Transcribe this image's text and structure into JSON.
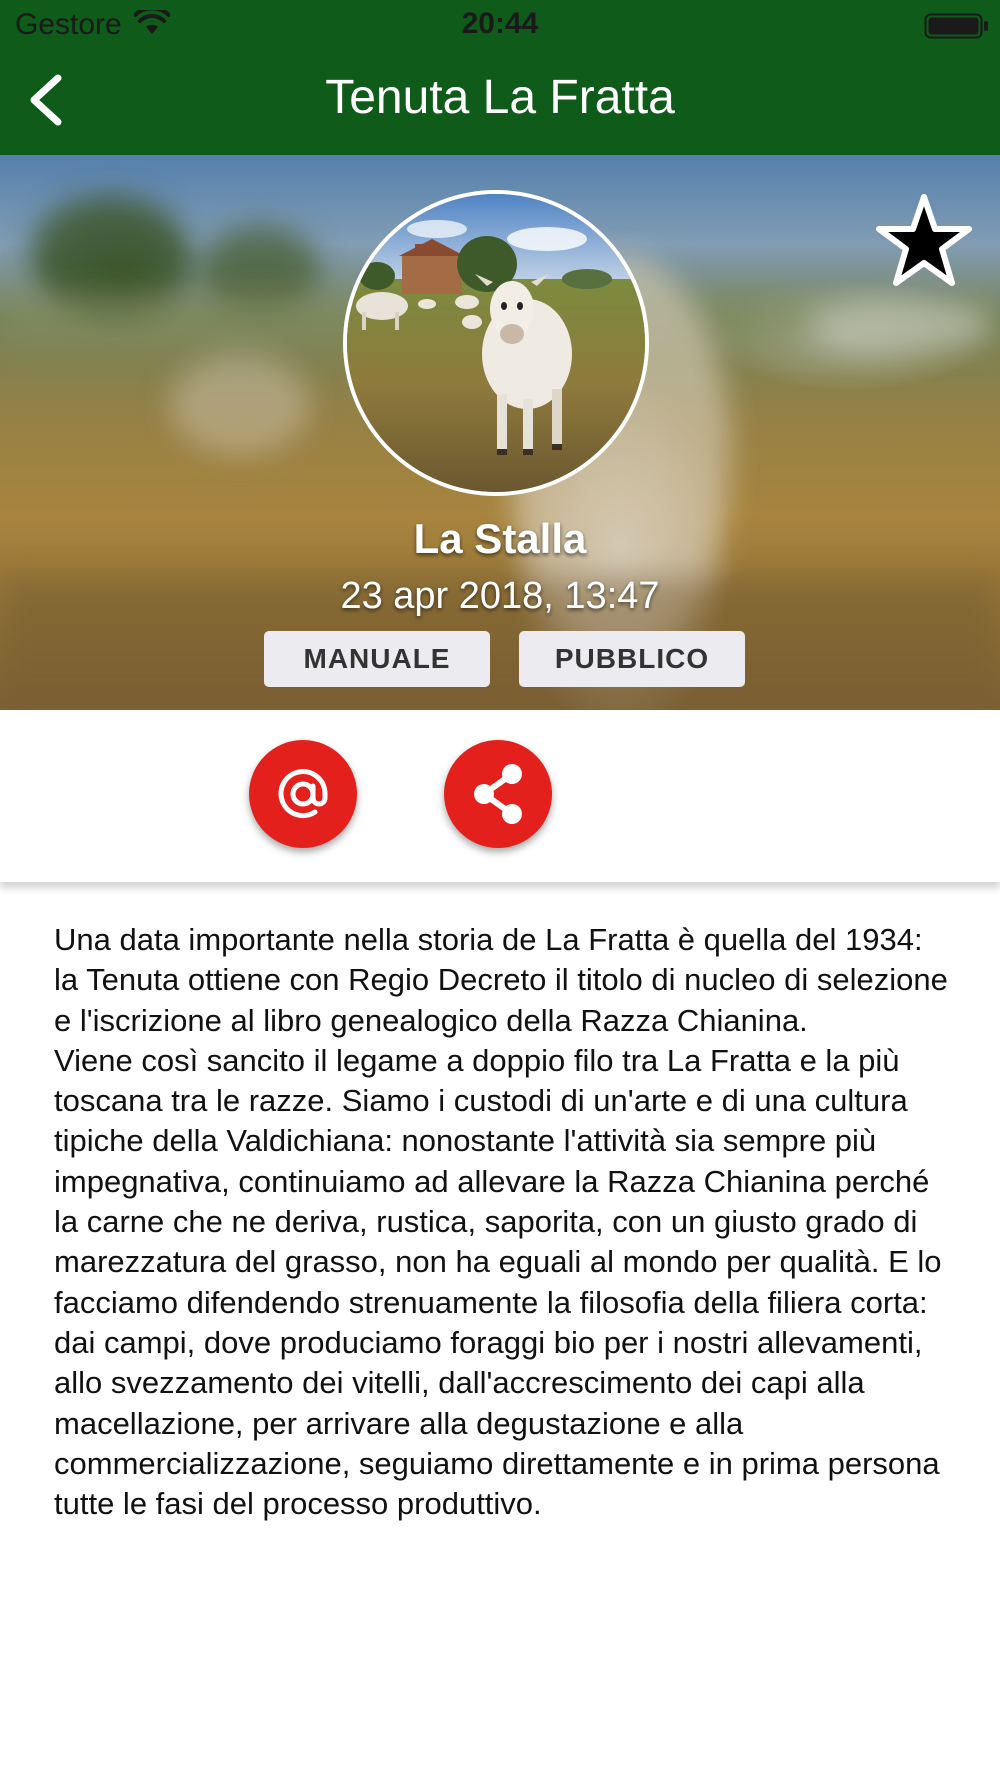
{
  "status_bar": {
    "carrier": "Gestore",
    "time": "20:44",
    "wifi_icon": "wifi-icon",
    "battery_icon": "battery-icon"
  },
  "nav": {
    "title": "Tenuta La Fratta",
    "back_icon": "chevron-left-icon"
  },
  "hero": {
    "favorite_icon": "star-icon",
    "name": "La Stalla",
    "date": "23 apr 2018, 13:47",
    "tags": [
      "MANUALE",
      "PUBBLICO"
    ]
  },
  "actions": {
    "email_icon": "at-sign-icon",
    "share_icon": "share-icon"
  },
  "description": "Una data importante nella storia de La Fratta è quella del 1934: la Tenuta ottiene con Regio Decreto il titolo di nucleo di selezione e l'iscrizione al libro genealogico della Razza Chianina.\nViene così sancito il legame a doppio filo tra La Fratta e la più toscana tra le razze. Siamo i custodi di un'arte e di una cultura tipiche della Valdichiana: nonostante l'attività sia sempre più impegnativa, continuiamo ad allevare la Razza Chianina perché la carne che ne deriva, rustica, saporita, con un giusto grado di marezzatura del grasso, non ha eguali al mondo per qualità. E lo facciamo difendendo strenuamente la filosofia della filiera corta: dai campi, dove produciamo foraggi bio per i nostri allevamenti, allo svezzamento dei vitelli, dall'accrescimento dei capi alla macellazione, per arrivare alla degustazione e alla commercializzazione, seguiamo direttamente e in prima persona tutte le fasi del processo produttivo.",
  "colors": {
    "nav_bar": "#0e5b1a",
    "fab": "#e3201b",
    "tag_bg": "#ececf0"
  }
}
